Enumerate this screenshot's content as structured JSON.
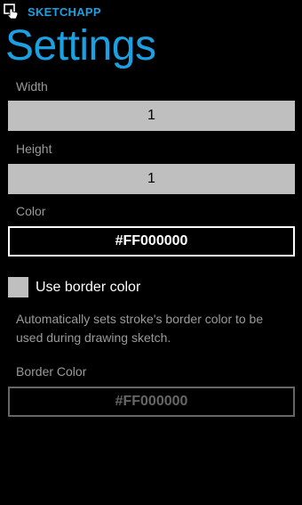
{
  "app": {
    "name": "SKETCHAPP",
    "icon": "touch-pointer-icon"
  },
  "page": {
    "title": "Settings"
  },
  "width": {
    "label": "Width",
    "value": "1"
  },
  "height": {
    "label": "Height",
    "value": "1"
  },
  "color": {
    "label": "Color",
    "value": "#FF000000"
  },
  "border_option": {
    "label": "Use border color",
    "checked": false,
    "description": "Automatically sets stroke's border color to be used during drawing sketch."
  },
  "border_color": {
    "label": "Border Color",
    "value": "#FF000000",
    "enabled": false
  },
  "theme": {
    "accent": "#1ba1e2",
    "background": "#000000",
    "subtle_text": "#9a9a9a",
    "textbox_fill": "#bfbfbf",
    "disabled": "#666666"
  }
}
